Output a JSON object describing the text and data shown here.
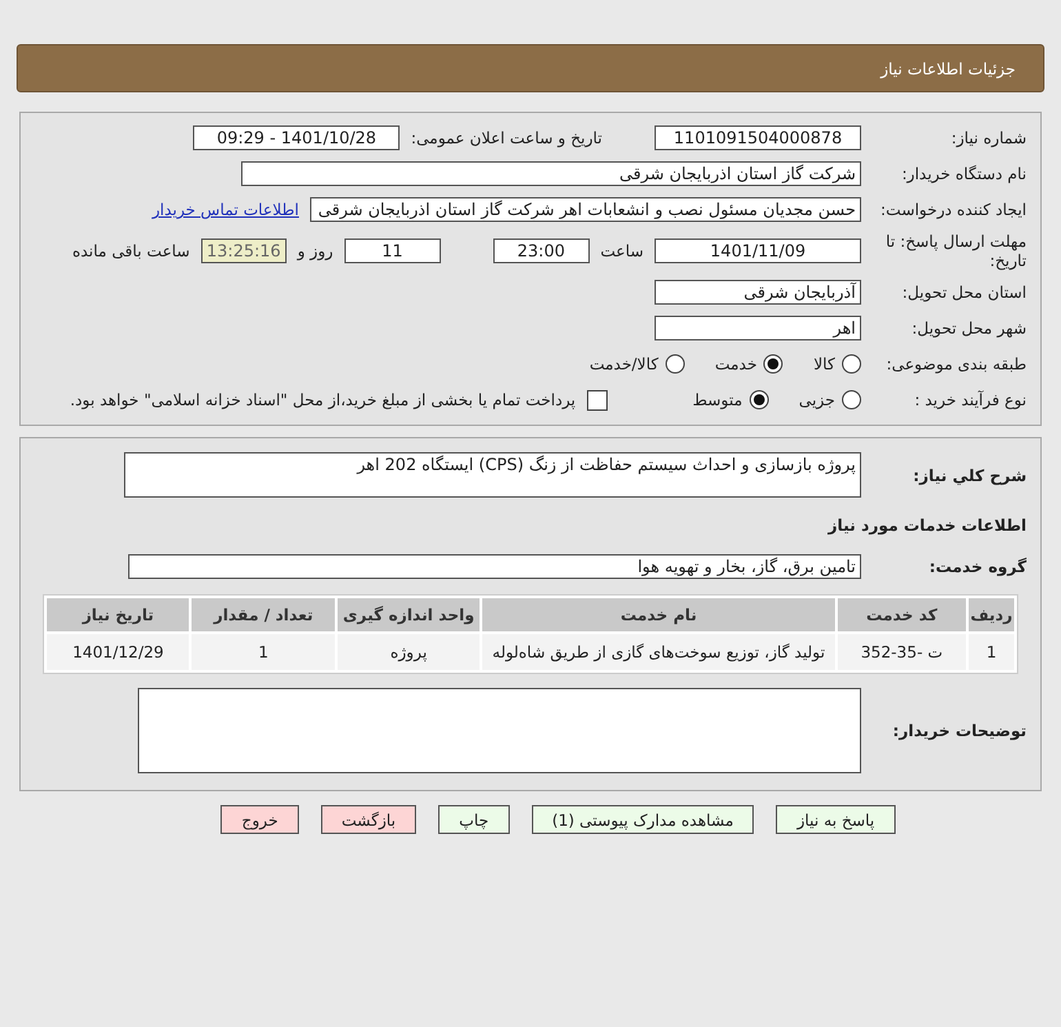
{
  "header": {
    "title": "جزئیات اطلاعات نیاز"
  },
  "need_number": {
    "label": "شماره نیاز:",
    "value": "1101091504000878"
  },
  "announce": {
    "label": "تاریخ و ساعت اعلان عمومی:",
    "value": "1401/10/28 - 09:29"
  },
  "buyer_org": {
    "label": "نام دستگاه خریدار:",
    "value": "شرکت گاز استان اذربایجان شرقی"
  },
  "creator": {
    "label": "ایجاد کننده درخواست:",
    "value": "حسن مجدیان مسئول نصب و انشعابات اهر  شرکت گاز استان اذربایجان شرقی",
    "link": "اطلاعات تماس خریدار"
  },
  "deadline": {
    "label": "مهلت ارسال پاسخ: تا تاریخ:",
    "date": "1401/11/09",
    "time_label": "ساعت",
    "time": "23:00",
    "days": "11",
    "days_label": "روز و",
    "remaining": "13:25:16",
    "remaining_label": "ساعت باقی مانده"
  },
  "province": {
    "label": "استان محل تحویل:",
    "value": "آذربایجان شرقی"
  },
  "city": {
    "label": "شهر محل تحویل:",
    "value": "اهر"
  },
  "category": {
    "label": "طبقه بندی موضوعی:",
    "options": [
      {
        "label": "کالا",
        "selected": false
      },
      {
        "label": "خدمت",
        "selected": true
      },
      {
        "label": "کالا/خدمت",
        "selected": false
      }
    ]
  },
  "process": {
    "label": "نوع فرآیند خرید :",
    "options": [
      {
        "label": "جزیی",
        "selected": false
      },
      {
        "label": "متوسط",
        "selected": true
      }
    ],
    "payment": {
      "checked": false,
      "text": "پرداخت تمام یا بخشی از مبلغ خرید،از محل \"اسناد خزانه اسلامی\" خواهد بود."
    }
  },
  "description": {
    "label": "شرح کلي نياز:",
    "value": "پروژه بازسازی و احداث سیستم حفاظت از زنگ (CPS) ایستگاه 202 اهر"
  },
  "services_heading": "اطلاعات خدمات مورد نیاز",
  "service_group": {
    "label": "گروه خدمت:",
    "value": "تامین برق، گاز، بخار و تهویه هوا"
  },
  "table": {
    "columns": [
      "ردیف",
      "کد خدمت",
      "نام خدمت",
      "واحد اندازه گیری",
      "تعداد / مقدار",
      "تاریخ نیاز"
    ],
    "rows": [
      [
        "1",
        "ت -35-352",
        "تولید گاز، توزیع سوخت‌های گازی از طریق شاه‌لوله",
        "پروژه",
        "1",
        "1401/12/29"
      ]
    ]
  },
  "buyer_notes": {
    "label": "توضیحات خریدار:"
  },
  "buttons": [
    {
      "label": "پاسخ به نیاز",
      "kind": "primary"
    },
    {
      "label": "مشاهده مدارک پیوستی (1)",
      "kind": "primary"
    },
    {
      "label": "چاپ",
      "kind": "primary"
    },
    {
      "label": "بازگشت",
      "kind": "danger"
    },
    {
      "label": "خروج",
      "kind": "danger"
    }
  ]
}
